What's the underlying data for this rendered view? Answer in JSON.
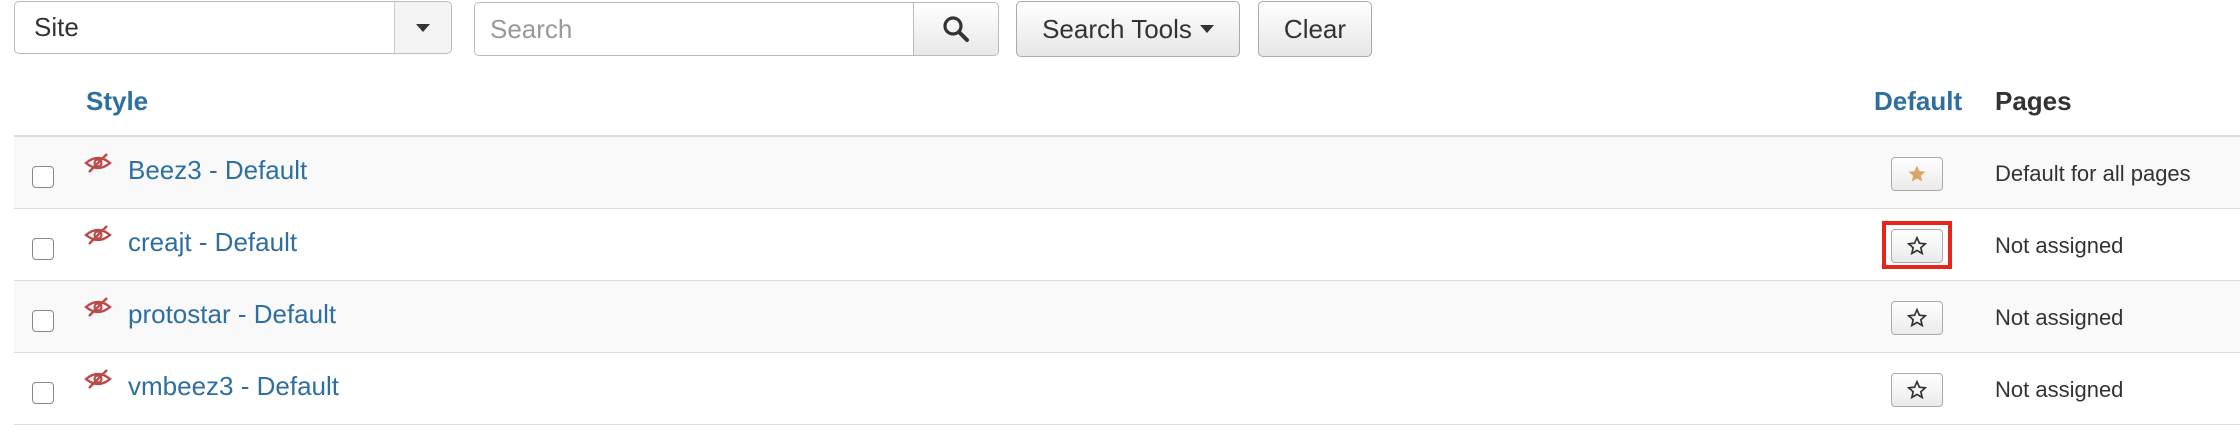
{
  "filter": {
    "site_value": "Site",
    "search_placeholder": "Search",
    "search_tools_label": "Search Tools",
    "clear_label": "Clear"
  },
  "table": {
    "headers": {
      "style": "Style",
      "default": "Default",
      "pages": "Pages"
    },
    "rows": [
      {
        "style": "Beez3 - Default",
        "is_default": true,
        "pages": "Default for all pages"
      },
      {
        "style": "creajt - Default",
        "is_default": false,
        "pages": "Not assigned",
        "highlighted": true
      },
      {
        "style": "protostar - Default",
        "is_default": false,
        "pages": "Not assigned"
      },
      {
        "style": "vmbeez3 - Default",
        "is_default": false,
        "pages": "Not assigned"
      }
    ]
  },
  "colors": {
    "link": "#2f6f9f",
    "default_star": "#d9a566",
    "hidden_eye": "#b94a48",
    "highlight_box": "#e8251b"
  },
  "icons": {
    "search": "search-icon",
    "caret": "caret-down-icon",
    "hidden": "eye-slash-icon",
    "star_filled": "star-filled-icon",
    "star_empty": "star-outline-icon"
  }
}
